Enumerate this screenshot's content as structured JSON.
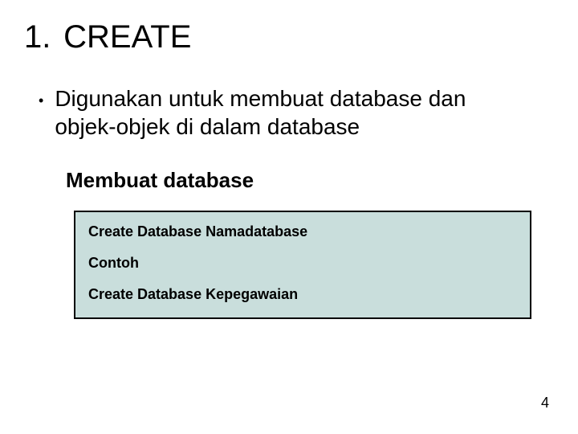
{
  "heading": {
    "number": "1.",
    "title": "CREATE"
  },
  "bullet": "Digunakan untuk membuat database dan objek-objek di dalam database",
  "sub_heading": "Membuat database",
  "code": {
    "line1": "Create Database Namadatabase",
    "line2": "Contoh",
    "line3": "Create Database Kepegawaian"
  },
  "page_number": "4"
}
